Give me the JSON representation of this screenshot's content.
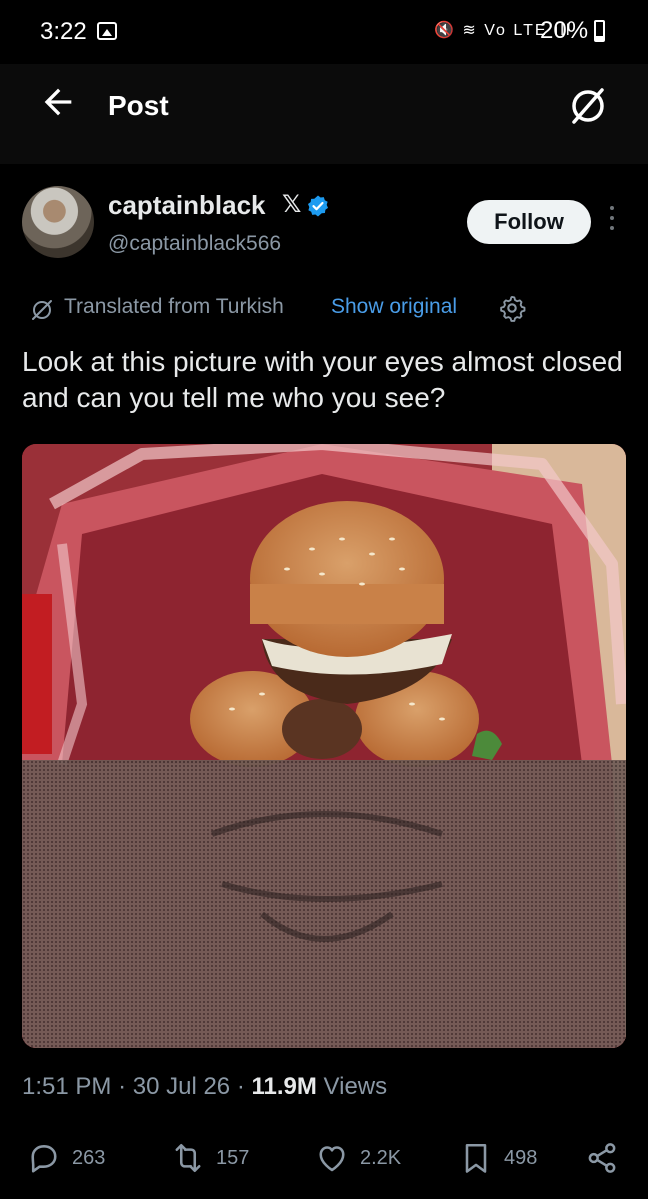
{
  "status_bar": {
    "time": "3:22",
    "network_icons": "🔇 ≋ Vo LTE ıll",
    "battery": "20%"
  },
  "header": {
    "title": "Post"
  },
  "author": {
    "display_name": "captainblack",
    "affiliate_mark": "𝕏",
    "handle": "@captainblack566",
    "follow_label": "Follow"
  },
  "translation": {
    "note": "Translated from Turkish",
    "show_original": "Show original"
  },
  "post": {
    "text": "Look at this picture with your eyes almost closed and can you tell me who you see?"
  },
  "meta": {
    "time": "1:51 PM",
    "date": "30 Jul 26",
    "views_count": "11.9M",
    "views_label": "Views",
    "separator": "·"
  },
  "actions": {
    "replies": "263",
    "reposts": "157",
    "likes": "2.2K",
    "bookmarks": "498"
  },
  "icons": {
    "back": "arrow-left-icon",
    "grok": "grok-icon",
    "verified": "verified-badge-icon",
    "more": "more-vertical-icon",
    "translate": "translate-icon",
    "settings": "gear-icon",
    "reply": "reply-icon",
    "repost": "repost-icon",
    "like": "heart-icon",
    "bookmark": "bookmark-icon",
    "share": "share-icon"
  },
  "colors": {
    "background": "#000000",
    "text": "#e7e9ea",
    "secondary": "#8b98a5",
    "link": "#4a9de8",
    "verified": "#1d9bf0"
  }
}
